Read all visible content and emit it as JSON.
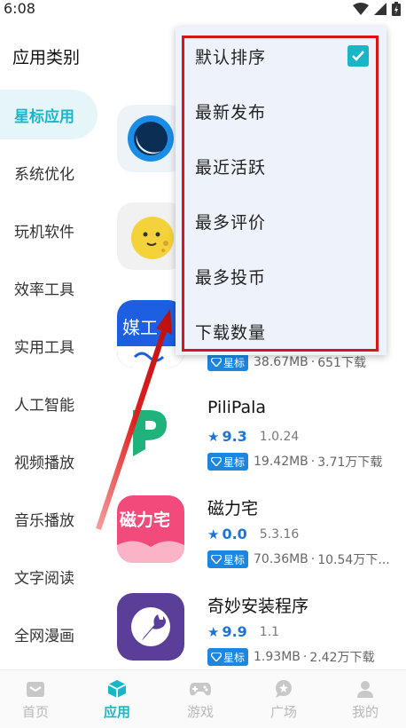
{
  "status_bar": {
    "time": "6:08"
  },
  "header": {
    "title": "应用类别"
  },
  "sidebar": {
    "items": [
      {
        "label": "星标应用",
        "active": true
      },
      {
        "label": "系统优化"
      },
      {
        "label": "玩机软件"
      },
      {
        "label": "效率工具"
      },
      {
        "label": "实用工具"
      },
      {
        "label": "人工智能"
      },
      {
        "label": "视频播放"
      },
      {
        "label": "音乐播放"
      },
      {
        "label": "文字阅读"
      },
      {
        "label": "全网漫画"
      }
    ]
  },
  "apps": [
    {
      "icon": "blue-ring-icon"
    },
    {
      "icon": "yellow-face-icon"
    },
    {
      "icon": "media-tool-icon",
      "icon_text": "媒工",
      "badge": "星标",
      "size": "38.67MB",
      "downloads": "651下载"
    },
    {
      "name": "PiliPala",
      "rating": "9.3",
      "version": "1.0.24",
      "badge": "星标",
      "size": "19.42MB",
      "downloads": "3.71万下载",
      "icon": "pilipala-icon"
    },
    {
      "name": "磁力宅",
      "rating": "0.0",
      "version": "5.3.16",
      "badge": "星标",
      "size": "70.36MB",
      "downloads": "10.54万下...",
      "icon": "magnet-home-icon",
      "icon_text": "磁力宅"
    },
    {
      "name": "奇妙安装程序",
      "rating": "9.9",
      "version": "1.1",
      "badge": "星标",
      "size": "1.93MB",
      "downloads": "2.42万下载",
      "icon": "wrench-icon"
    }
  ],
  "sort_menu": {
    "items": [
      {
        "label": "默认排序",
        "checked": true
      },
      {
        "label": "最新发布"
      },
      {
        "label": "最近活跃"
      },
      {
        "label": "最多评价"
      },
      {
        "label": "最多投币"
      },
      {
        "label": "下载数量"
      }
    ]
  },
  "bottom_nav": {
    "items": [
      {
        "label": "首页",
        "icon": "home-icon"
      },
      {
        "label": "应用",
        "icon": "cube-icon",
        "active": true
      },
      {
        "label": "游戏",
        "icon": "gamepad-icon"
      },
      {
        "label": "广场",
        "icon": "chat-star-icon"
      },
      {
        "label": "我的",
        "icon": "user-icon"
      }
    ]
  },
  "colors": {
    "accent": "#19b6c8",
    "rating_blue": "#1c74d9",
    "badge_blue": "#1c86e0",
    "annotation_red": "#d8141b"
  }
}
